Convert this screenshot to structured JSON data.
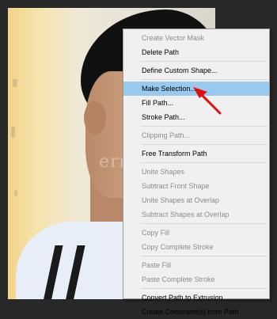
{
  "watermark": "ermasworld",
  "context_menu": {
    "groups": [
      [
        {
          "label": "Create Vector Mask",
          "enabled": false
        },
        {
          "label": "Delete Path",
          "enabled": true
        }
      ],
      [
        {
          "label": "Define Custom Shape...",
          "enabled": true
        }
      ],
      [
        {
          "label": "Make Selection...",
          "enabled": true,
          "highlighted": true
        },
        {
          "label": "Fill Path...",
          "enabled": true
        },
        {
          "label": "Stroke Path...",
          "enabled": true
        }
      ],
      [
        {
          "label": "Clipping Path...",
          "enabled": false
        }
      ],
      [
        {
          "label": "Free Transform Path",
          "enabled": true
        }
      ],
      [
        {
          "label": "Unite Shapes",
          "enabled": false
        },
        {
          "label": "Subtract Front Shape",
          "enabled": false
        },
        {
          "label": "Unite Shapes at Overlap",
          "enabled": false
        },
        {
          "label": "Subtract Shapes at Overlap",
          "enabled": false
        }
      ],
      [
        {
          "label": "Copy Fill",
          "enabled": false
        },
        {
          "label": "Copy Complete Stroke",
          "enabled": false
        }
      ],
      [
        {
          "label": "Paste Fill",
          "enabled": false
        },
        {
          "label": "Paste Complete Stroke",
          "enabled": false
        }
      ],
      [
        {
          "label": "Convert Path to Extrusion",
          "enabled": true
        },
        {
          "label": "Create Constraint(s) from Path",
          "enabled": true
        }
      ]
    ]
  },
  "colors": {
    "highlight": "#99c9ef",
    "annotation_arrow": "#e01010",
    "disabled_text": "#8c8c8c"
  }
}
